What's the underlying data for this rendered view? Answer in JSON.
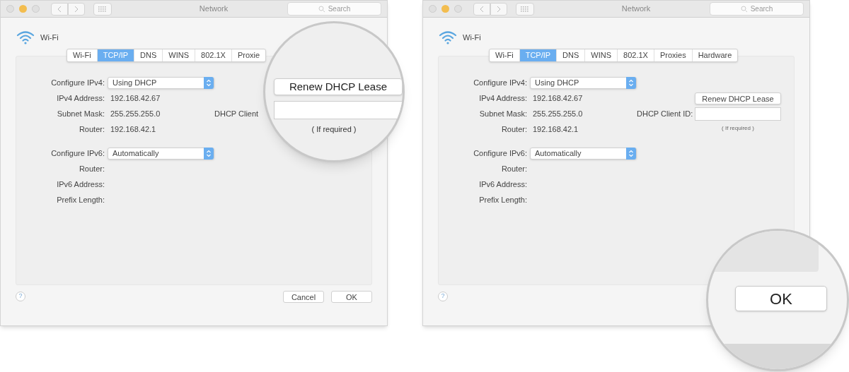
{
  "panels": [
    {
      "title": "Network",
      "search_placeholder": "Search",
      "service": "Wi-Fi",
      "tabs": [
        {
          "label": "Wi-Fi",
          "selected": false
        },
        {
          "label": "TCP/IP",
          "selected": true
        },
        {
          "label": "DNS",
          "selected": false
        },
        {
          "label": "WINS",
          "selected": false
        },
        {
          "label": "802.1X",
          "selected": false
        },
        {
          "label": "Proxie",
          "selected": false
        }
      ],
      "ipv4_rows": [
        {
          "kind": "popup",
          "label": "Configure IPv4:",
          "value": "Using DHCP"
        },
        {
          "kind": "value",
          "label": "IPv4 Address:",
          "value": "192.168.42.67"
        },
        {
          "kind": "value",
          "label": "Subnet Mask:",
          "value": "255.255.255.0"
        },
        {
          "kind": "value",
          "label": "Router:",
          "value": "192.168.42.1"
        }
      ],
      "ipv6_rows": [
        {
          "kind": "popup",
          "label": "Configure IPv6:",
          "value": "Automatically"
        },
        {
          "kind": "value",
          "label": "Router:"
        },
        {
          "kind": "value",
          "label": "IPv6 Address:"
        },
        {
          "kind": "value",
          "label": "Prefix Length:"
        }
      ],
      "dhcp": {
        "client_label": "DHCP Client"
      },
      "help": "?",
      "buttons": [
        "Cancel",
        "OK"
      ],
      "magnifier": {
        "kind": "dhcp",
        "button": "Renew DHCP Lease",
        "hint": "( If required )"
      }
    },
    {
      "title": "Network",
      "search_placeholder": "Search",
      "service": "Wi-Fi",
      "tabs": [
        {
          "label": "Wi-Fi",
          "selected": false
        },
        {
          "label": "TCP/IP",
          "selected": true
        },
        {
          "label": "DNS",
          "selected": false
        },
        {
          "label": "WINS",
          "selected": false
        },
        {
          "label": "802.1X",
          "selected": false
        },
        {
          "label": "Proxies",
          "selected": false
        },
        {
          "label": "Hardware",
          "selected": false
        }
      ],
      "ipv4_rows": [
        {
          "kind": "popup",
          "label": "Configure IPv4:",
          "value": "Using DHCP"
        },
        {
          "kind": "value",
          "label": "IPv4 Address:",
          "value": "192.168.42.67"
        },
        {
          "kind": "value",
          "label": "Subnet Mask:",
          "value": "255.255.255.0"
        },
        {
          "kind": "value",
          "label": "Router:",
          "value": "192.168.42.1"
        }
      ],
      "ipv6_rows": [
        {
          "kind": "popup",
          "label": "Configure IPv6:",
          "value": "Automatically"
        },
        {
          "kind": "value",
          "label": "Router:"
        },
        {
          "kind": "value",
          "label": "IPv6 Address:"
        },
        {
          "kind": "value",
          "label": "Prefix Length:"
        }
      ],
      "dhcp": {
        "renew_button": "Renew DHCP Lease",
        "client_label": "DHCP Client ID:",
        "hint": "( If required )"
      },
      "help": "?",
      "magnifier": {
        "kind": "ok",
        "button": "OK"
      }
    }
  ]
}
